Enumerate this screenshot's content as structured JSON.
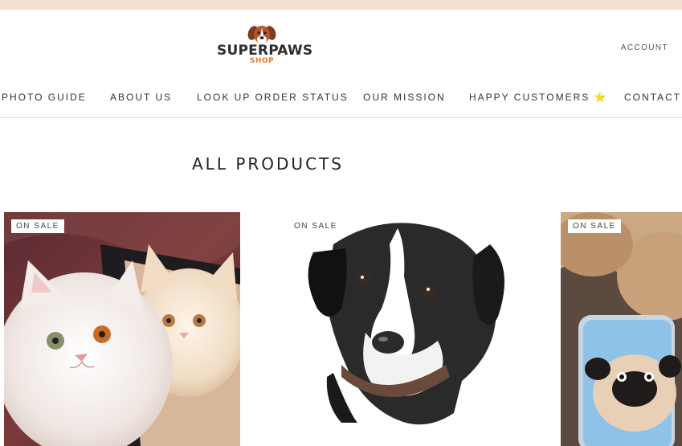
{
  "logo": {
    "name": "SUPERPAWS",
    "sub": "SHOP"
  },
  "header": {
    "account_label": "ACCOUNT"
  },
  "nav": {
    "items": [
      {
        "label": "PHOTO GUIDE"
      },
      {
        "label": "ABOUT US"
      },
      {
        "label": "LOOK UP ORDER STATUS"
      },
      {
        "label": "OUR MISSION"
      },
      {
        "label": "HAPPY CUSTOMERS ⭐"
      },
      {
        "label": "CONTACT"
      }
    ]
  },
  "page": {
    "title": "ALL PRODUCTS"
  },
  "products": [
    {
      "badge": "ON SALE"
    },
    {
      "badge": "ON SALE"
    },
    {
      "badge": "ON SALE"
    }
  ],
  "colors": {
    "announce_bar": "#f1dfcf",
    "logo_accent": "#e07a2c"
  }
}
